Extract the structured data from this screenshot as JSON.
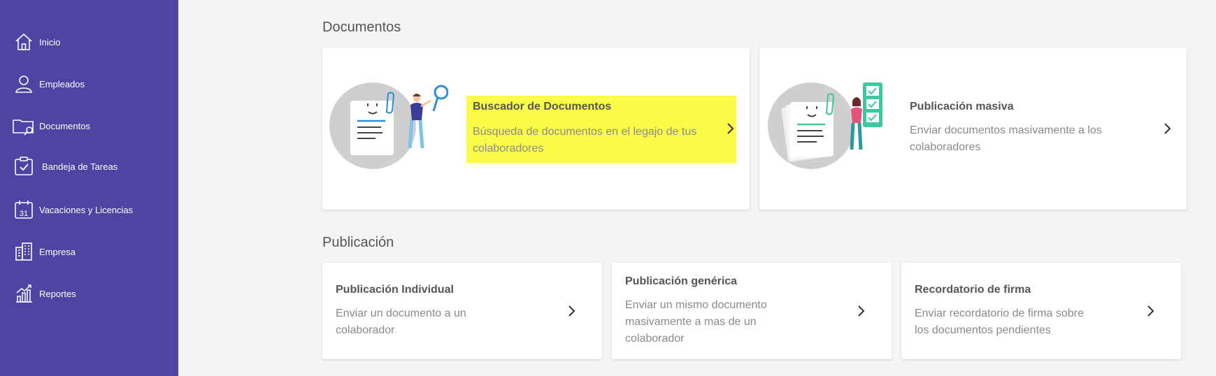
{
  "sidebar": {
    "items": [
      {
        "label": "Inicio",
        "icon": "home-icon"
      },
      {
        "label": "Empleados",
        "icon": "user-icon"
      },
      {
        "label": "Documentos",
        "icon": "folder-search-icon"
      },
      {
        "label": "Bandeja de Tareas",
        "icon": "clipboard-check-icon"
      },
      {
        "label": "Vacaciones y Licencias",
        "icon": "calendar-icon"
      },
      {
        "label": "Empresa",
        "icon": "building-icon"
      },
      {
        "label": "Reportes",
        "icon": "chart-growth-icon"
      }
    ],
    "calendar_day": "31",
    "background": "#4e44a4"
  },
  "documentos": {
    "title": "Documentos",
    "cards": [
      {
        "title": "Buscador de Documentos",
        "desc_lines": [
          "Búsqueda de documentos en el legajo de tus",
          "colaboradores"
        ],
        "highlighted": true
      },
      {
        "title": "Publicación masiva",
        "desc_lines": [
          "Enviar documentos masivamente a los",
          "colaboradores"
        ],
        "highlighted": false
      }
    ]
  },
  "publicacion": {
    "title": "Publicación",
    "cards": [
      {
        "title": "Publicación Individual",
        "desc_lines": [
          "Enviar un documento a un",
          "colaborador"
        ]
      },
      {
        "title": "Publicación genérica",
        "desc_lines": [
          "Enviar un mismo documento",
          "masivamente a mas de un",
          "colaborador"
        ]
      },
      {
        "title": "Recordatorio de firma",
        "desc_lines": [
          "Enviar recordatorio de firma sobre",
          "los documentos pendientes"
        ]
      }
    ]
  },
  "colors": {
    "highlight": "#fbfb4a",
    "accent_blue": "#2b8fd6",
    "accent_green": "#3ec8a0"
  }
}
